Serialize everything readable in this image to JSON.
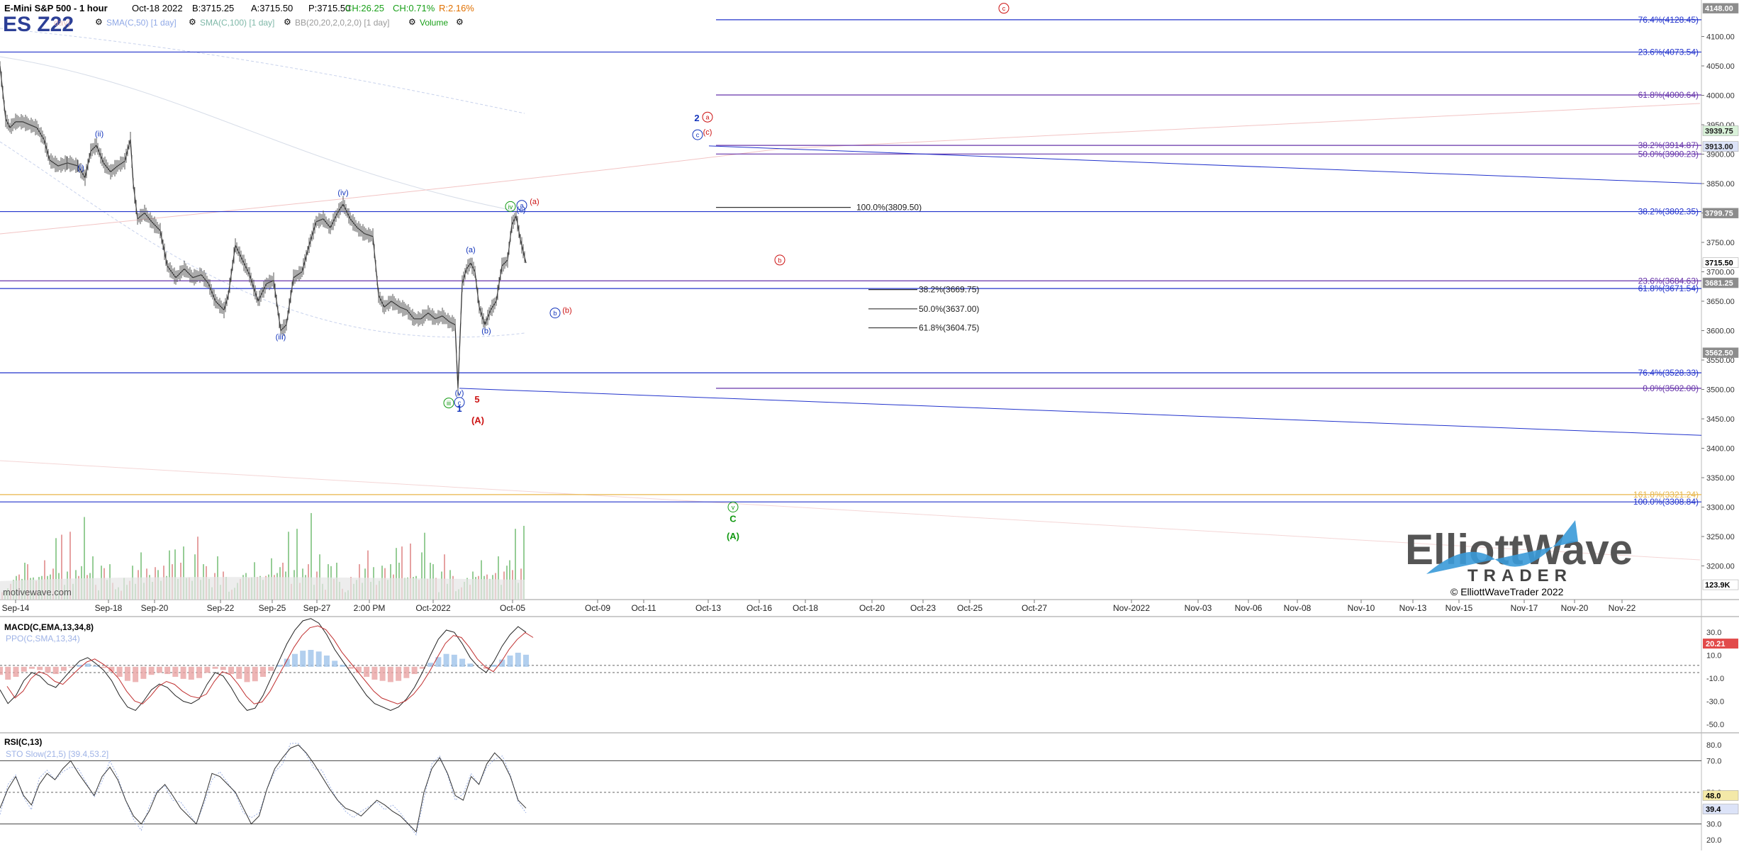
{
  "header": {
    "title": "E-Mini S&P 500 - 1 hour",
    "date": "Oct-18 2022",
    "bid": "B:3715.25",
    "ask": "A:3715.50",
    "price": "P:3715.50",
    "change": "CH:26.25",
    "change_pct": "CH:0.71%",
    "range": "R:2.16%",
    "symbol": "ES Z22",
    "indicators": [
      "SMA(C,50) [1 day]",
      "SMA(C,100) [1 day]",
      "BB(20,20,2,0,2,0) [1 day]",
      "Volume"
    ],
    "faded_indicator": "day]"
  },
  "colors": {
    "price": "#333333",
    "fib_blue": "#2233cc",
    "fib_purple": "#6633aa",
    "gold": "#e8b64a",
    "pink": "#f2c4c4",
    "label_green": "#119911",
    "label_red": "#cc1111",
    "label_blue": "#1133bb",
    "volume_green": "#7cc07c",
    "volume_red": "#e08a8a"
  },
  "chart_data": {
    "type": "line",
    "title": "E-Mini S&P 500 - 1 hour",
    "series_name": "ES Z22",
    "ylim": [
      3150,
      4150
    ],
    "y_ticks": [
      3200,
      3250,
      3300,
      3350,
      3400,
      3450,
      3500,
      3550,
      3600,
      3650,
      3700,
      3750,
      3800,
      3850,
      3900,
      3950,
      4000,
      4050,
      4100
    ],
    "x_labels": [
      "Sep-14",
      "Sep-18",
      "Sep-20",
      "Sep-22",
      "Sep-25",
      "Sep-27",
      "2:00 PM",
      "Oct-2022",
      "Oct-05",
      "Oct-09",
      "Oct-11",
      "Oct-13",
      "Oct-16",
      "Oct-18",
      "Oct-20",
      "Oct-23",
      "Oct-25",
      "Oct-27",
      "Nov-2022",
      "Nov-03",
      "Nov-06",
      "Nov-08",
      "Nov-10",
      "Nov-13",
      "Nov-15",
      "Nov-17",
      "Nov-20",
      "Nov-22"
    ],
    "price_path": [
      [
        0,
        4050
      ],
      [
        8,
        3960
      ],
      [
        14,
        3945
      ],
      [
        22,
        3955
      ],
      [
        32,
        3955
      ],
      [
        42,
        3950
      ],
      [
        52,
        3945
      ],
      [
        62,
        3925
      ],
      [
        70,
        3890
      ],
      [
        82,
        3880
      ],
      [
        95,
        3885
      ],
      [
        110,
        3880
      ],
      [
        120,
        3860
      ],
      [
        128,
        3905
      ],
      [
        136,
        3915
      ],
      [
        146,
        3885
      ],
      [
        156,
        3870
      ],
      [
        166,
        3880
      ],
      [
        176,
        3888
      ],
      [
        184,
        3925
      ],
      [
        188,
        3850
      ],
      [
        194,
        3790
      ],
      [
        204,
        3800
      ],
      [
        214,
        3785
      ],
      [
        226,
        3770
      ],
      [
        236,
        3710
      ],
      [
        248,
        3690
      ],
      [
        260,
        3705
      ],
      [
        272,
        3690
      ],
      [
        284,
        3695
      ],
      [
        294,
        3680
      ],
      [
        304,
        3650
      ],
      [
        316,
        3635
      ],
      [
        322,
        3660
      ],
      [
        332,
        3745
      ],
      [
        342,
        3720
      ],
      [
        352,
        3695
      ],
      [
        364,
        3650
      ],
      [
        376,
        3680
      ],
      [
        386,
        3685
      ],
      [
        396,
        3600
      ],
      [
        404,
        3610
      ],
      [
        414,
        3690
      ],
      [
        426,
        3700
      ],
      [
        436,
        3745
      ],
      [
        446,
        3785
      ],
      [
        456,
        3790
      ],
      [
        466,
        3775
      ],
      [
        476,
        3800
      ],
      [
        484,
        3815
      ],
      [
        494,
        3790
      ],
      [
        504,
        3775
      ],
      [
        514,
        3765
      ],
      [
        526,
        3760
      ],
      [
        534,
        3660
      ],
      [
        542,
        3640
      ],
      [
        552,
        3650
      ],
      [
        564,
        3640
      ],
      [
        574,
        3635
      ],
      [
        584,
        3620
      ],
      [
        594,
        3620
      ],
      [
        604,
        3630
      ],
      [
        614,
        3620
      ],
      [
        624,
        3625
      ],
      [
        634,
        3615
      ],
      [
        642,
        3610
      ],
      [
        646,
        3502
      ],
      [
        652,
        3680
      ],
      [
        658,
        3705
      ],
      [
        664,
        3715
      ],
      [
        670,
        3700
      ],
      [
        676,
        3640
      ],
      [
        684,
        3610
      ],
      [
        692,
        3635
      ],
      [
        700,
        3650
      ],
      [
        708,
        3710
      ],
      [
        716,
        3720
      ],
      [
        722,
        3780
      ],
      [
        728,
        3795
      ],
      [
        734,
        3755
      ],
      [
        742,
        3715
      ]
    ],
    "volume_bars": [
      1,
      1,
      1,
      2,
      2,
      2,
      3,
      2,
      3,
      4,
      2,
      3,
      2,
      2,
      3,
      4,
      2,
      3,
      3,
      5,
      3,
      6,
      2,
      3,
      6,
      2,
      3,
      2,
      4,
      8,
      2,
      3,
      4,
      2,
      1,
      3,
      4,
      2,
      3,
      2
    ],
    "fib_levels": [
      {
        "label": "76.4%(4128.45)",
        "value": 4128.45
      },
      {
        "label": "23.6%(4073.54)",
        "value": 4073.54
      },
      {
        "label": "61.8%(4000.64)",
        "value": 4000.64
      },
      {
        "label": "38.2%(3914.87)",
        "value": 3914.87
      },
      {
        "label": "50.0%(3900.23)",
        "value": 3900.23
      },
      {
        "label": "100.0%(3809.50)",
        "value": 3809.5
      },
      {
        "label": "38.2%(3802.35)",
        "value": 3802.35
      },
      {
        "label": "23.6%(3684.63)",
        "value": 3684.63
      },
      {
        "label": "61.8%(3671.54)",
        "value": 3671.54
      },
      {
        "label": "38.2%(3669.75)",
        "value": 3669.75
      },
      {
        "label": "50.0%(3637.00)",
        "value": 3637.0
      },
      {
        "label": "61.8%(3604.75)",
        "value": 3604.75
      },
      {
        "label": "76.4%(3528.33)",
        "value": 3528.33
      },
      {
        "label": "0.0%(3502.00)",
        "value": 3502.0
      },
      {
        "label": "161.8%(3321.24)",
        "value": 3321.24
      },
      {
        "label": "100.0%(3308.84)",
        "value": 3308.84
      }
    ],
    "price_tags": [
      {
        "text": "4148.00",
        "value": 4148,
        "style": "grey"
      },
      {
        "text": "3939.75",
        "value": 3939.75,
        "style": "green"
      },
      {
        "text": "3913.00",
        "value": 3913,
        "style": "blue"
      },
      {
        "text": "3799.75",
        "value": 3799.75,
        "style": "grey"
      },
      {
        "text": "3715.50",
        "value": 3715.5,
        "style": "white"
      },
      {
        "text": "3681.25",
        "value": 3681.25,
        "style": "grey"
      },
      {
        "text": "3562.50",
        "value": 3562.5,
        "style": "grey"
      },
      {
        "text": "123.9K",
        "value": 3168,
        "style": "white"
      }
    ],
    "wave_labels": [
      {
        "text": "(i)",
        "x": 114,
        "y": 3872,
        "color": "label_blue"
      },
      {
        "text": "(ii)",
        "x": 140,
        "y": 3930,
        "color": "label_blue"
      },
      {
        "text": "(iii)",
        "x": 396,
        "y": 3585,
        "color": "label_blue"
      },
      {
        "text": "(iv)",
        "x": 484,
        "y": 3830,
        "color": "label_blue"
      },
      {
        "text": "(v)",
        "x": 648,
        "y": 3490,
        "color": "label_blue"
      },
      {
        "text": "(a)",
        "x": 664,
        "y": 3733,
        "color": "label_blue"
      },
      {
        "text": "(b)",
        "x": 686,
        "y": 3595,
        "color": "label_blue"
      },
      {
        "text": "(c)",
        "x": 735,
        "y": 3801,
        "color": "label_blue"
      },
      {
        "text": "(a)",
        "x": 754,
        "y": 3815,
        "color": "label_red"
      },
      {
        "text": "(b)",
        "x": 800,
        "y": 3630,
        "color": "label_red"
      },
      {
        "text": "(c)",
        "x": 998,
        "y": 3933,
        "color": "label_red"
      },
      {
        "text": "5",
        "x": 673,
        "y": 3478,
        "color": "label_red"
      },
      {
        "text": "(A)",
        "x": 674,
        "y": 3442,
        "color": "label_red"
      },
      {
        "text": "1",
        "x": 648,
        "y": 3462,
        "color": "label_blue"
      },
      {
        "text": "2",
        "x": 983,
        "y": 3956,
        "color": "label_blue"
      },
      {
        "text": "C",
        "x": 1034,
        "y": 3275,
        "color": "label_green"
      },
      {
        "text": "(A)",
        "x": 1034,
        "y": 3245,
        "color": "label_green"
      }
    ],
    "circled_labels": [
      {
        "text": "iii",
        "x": 633,
        "y": 3477,
        "color": "label_green"
      },
      {
        "text": "c",
        "x": 648,
        "y": 3478,
        "color": "label_blue"
      },
      {
        "text": "iv",
        "x": 720,
        "y": 3811,
        "color": "label_green"
      },
      {
        "text": "a",
        "x": 736,
        "y": 3813,
        "color": "label_blue"
      },
      {
        "text": "b",
        "x": 783,
        "y": 3630,
        "color": "label_blue"
      },
      {
        "text": "c",
        "x": 984,
        "y": 3933,
        "color": "label_blue"
      },
      {
        "text": "a",
        "x": 998,
        "y": 3963,
        "color": "label_red"
      },
      {
        "text": "b",
        "x": 1100,
        "y": 3720,
        "color": "label_red"
      },
      {
        "text": "c",
        "x": 1416,
        "y": 4148,
        "color": "label_red"
      },
      {
        "text": "v",
        "x": 1034,
        "y": 3300,
        "color": "label_green"
      }
    ]
  },
  "macd": {
    "title": "MACD(C,EMA,13,34,8)",
    "subtitle": "PPO(C,SMA,13,34)",
    "ticks": [
      "30.0",
      "10.0",
      "-10.0",
      "-30.0",
      "-50.0"
    ],
    "tag": "20.21",
    "values": [
      -20,
      -32,
      -25,
      -12,
      -5,
      -8,
      -15,
      -18,
      -10,
      -2,
      5,
      8,
      3,
      -3,
      -12,
      -25,
      -35,
      -38,
      -30,
      -20,
      -15,
      -18,
      -25,
      -30,
      -32,
      -28,
      -15,
      -5,
      -8,
      -18,
      -30,
      -38,
      -36,
      -25,
      -10,
      5,
      20,
      32,
      40,
      42,
      38,
      28,
      15,
      5,
      -5,
      -15,
      -25,
      -32,
      -35,
      -38,
      -35,
      -28,
      -18,
      -5,
      10,
      24,
      32,
      30,
      20,
      8,
      0,
      -5,
      5,
      18,
      28,
      35,
      30
    ]
  },
  "rsi": {
    "title": "RSI(C,13)",
    "subtitle": "STO Slow(21,5) [39.4,53.2]",
    "ticks": [
      "80.0",
      "70.0",
      "50.0",
      "30.0",
      "20.0"
    ],
    "tag_a": "48.0",
    "tag_b": "39.4",
    "values": [
      40,
      52,
      60,
      48,
      42,
      55,
      62,
      58,
      65,
      70,
      62,
      55,
      48,
      60,
      66,
      58,
      45,
      35,
      30,
      38,
      50,
      55,
      48,
      40,
      35,
      30,
      45,
      62,
      60,
      55,
      50,
      40,
      30,
      35,
      52,
      65,
      72,
      78,
      80,
      75,
      68,
      60,
      52,
      45,
      40,
      38,
      35,
      40,
      45,
      42,
      38,
      35,
      30,
      25,
      50,
      65,
      72,
      62,
      48,
      45,
      60,
      55,
      68,
      75,
      70,
      60,
      45,
      40
    ]
  },
  "logo": {
    "line1": "ElliottWave",
    "line2": "TRADER",
    "copyright": "© ElliottWaveTrader 2022"
  },
  "footer": {
    "watermark": "motivewave.com"
  }
}
